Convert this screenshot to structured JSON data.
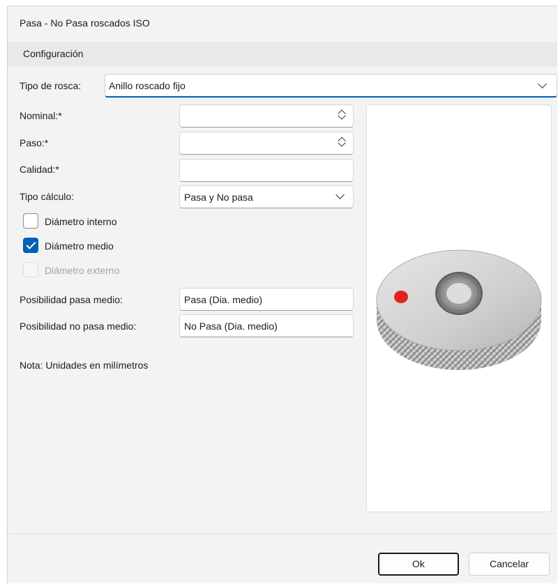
{
  "window": {
    "title": "Pasa - No Pasa roscados ISO"
  },
  "section": {
    "title": "Configuración"
  },
  "thread_type": {
    "label": "Tipo de rosca:",
    "value": "Anillo roscado fijo"
  },
  "fields": {
    "nominal": {
      "label": "Nominal:*",
      "value": ""
    },
    "paso": {
      "label": "Paso:*",
      "value": ""
    },
    "calidad": {
      "label": "Calidad:*",
      "value": ""
    },
    "tipo_calculo": {
      "label": "Tipo cálculo:",
      "value": "Pasa y No pasa"
    }
  },
  "checkboxes": {
    "interno": {
      "label": "Diámetro interno",
      "checked": false,
      "enabled": true
    },
    "medio": {
      "label": "Diámetro medio",
      "checked": true,
      "enabled": true
    },
    "externo": {
      "label": "Diámetro externo",
      "checked": false,
      "enabled": false
    }
  },
  "possibility": {
    "pasa_medio": {
      "label": "Posibilidad pasa medio:",
      "value": "Pasa (Dia. medio)"
    },
    "no_pasa_medio": {
      "label": "Posibilidad no pasa medio:",
      "value": "No Pasa (Dia. medio)"
    }
  },
  "note": "Nota: Unidades en milímetros",
  "buttons": {
    "ok": "Ok",
    "cancel": "Cancelar"
  },
  "colors": {
    "accent": "#005fb8",
    "background": "#f3f3f3",
    "section": "#e9e9e9"
  },
  "icons": [
    "chevron-down-icon",
    "spin-updown-icon",
    "checkmark-icon",
    "thread-ring-gauge-image"
  ]
}
